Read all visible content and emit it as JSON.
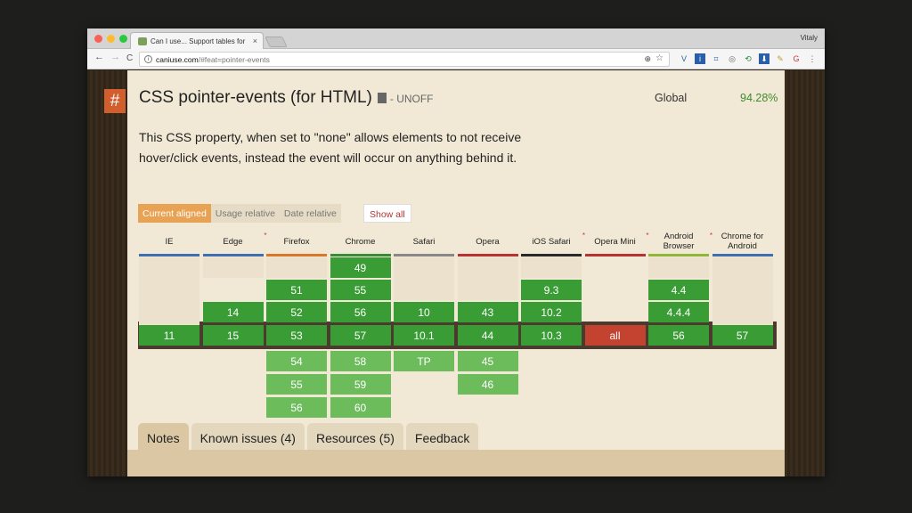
{
  "window": {
    "tab_title": "Can I use... Support tables for",
    "tab_close": "×",
    "user": "Vitaly"
  },
  "toolbar": {
    "back": "←",
    "forward": "→",
    "reload": "C",
    "info": "i",
    "url_host": "caniuse.com",
    "url_path": "/#feat=pointer-events",
    "zoom": "⊕",
    "star": "☆",
    "extensions": [
      "V",
      "i",
      "⌗",
      "◎",
      "⟲",
      "⬇",
      "✎",
      "G",
      "⋮"
    ]
  },
  "page": {
    "hash": "#",
    "title": "CSS pointer-events (for HTML)",
    "status": "- UNOFF",
    "global_label": "Global",
    "global_pct": "94.28%",
    "description": "This CSS property, when set to \"none\" allows elements to not receive hover/click events, instead the event will occur on anything behind it.",
    "view_buttons": [
      "Current aligned",
      "Usage relative",
      "Date relative"
    ],
    "show_all": "Show all",
    "browsers": [
      {
        "name": "IE",
        "color": "#3f6fb0",
        "note": "",
        "cells": [
          [
            "",
            "empty"
          ],
          [
            "",
            "empty"
          ],
          [
            "",
            "empty"
          ],
          [
            "11",
            "cur"
          ],
          [
            "",
            "none"
          ],
          [
            "",
            "none"
          ],
          [
            "",
            "none"
          ]
        ]
      },
      {
        "name": "Edge",
        "color": "#3f6fb0",
        "note": "*",
        "cells": [
          [
            "",
            "none"
          ],
          [
            "",
            "empty"
          ],
          [
            "14",
            "old"
          ],
          [
            "15",
            "cur"
          ],
          [
            "",
            "none"
          ],
          [
            "",
            "none"
          ],
          [
            "",
            "none"
          ]
        ]
      },
      {
        "name": "Firefox",
        "color": "#d9772b",
        "note": "",
        "cells": [
          [
            "",
            "empty"
          ],
          [
            "51",
            "old"
          ],
          [
            "52",
            "old"
          ],
          [
            "53",
            "cur"
          ],
          [
            "54",
            "fut"
          ],
          [
            "55",
            "fut"
          ],
          [
            "56",
            "fut"
          ]
        ]
      },
      {
        "name": "Chrome",
        "color": "#3a8a3a",
        "note": "",
        "cells": [
          [
            "49",
            "old"
          ],
          [
            "55",
            "old"
          ],
          [
            "56",
            "old"
          ],
          [
            "57",
            "cur"
          ],
          [
            "58",
            "fut"
          ],
          [
            "59",
            "fut"
          ],
          [
            "60",
            "fut"
          ]
        ]
      },
      {
        "name": "Safari",
        "color": "#888888",
        "note": "",
        "cells": [
          [
            "",
            "empty"
          ],
          [
            "",
            "empty"
          ],
          [
            "10",
            "old"
          ],
          [
            "10.1",
            "cur"
          ],
          [
            "TP",
            "fut"
          ],
          [
            "",
            "none"
          ],
          [
            "",
            "none"
          ]
        ]
      },
      {
        "name": "Opera",
        "color": "#b93232",
        "note": "",
        "cells": [
          [
            "",
            "empty"
          ],
          [
            "",
            "empty"
          ],
          [
            "43",
            "old"
          ],
          [
            "44",
            "cur"
          ],
          [
            "45",
            "fut"
          ],
          [
            "46",
            "fut"
          ],
          [
            "",
            "none"
          ]
        ]
      },
      {
        "name": "iOS Safari",
        "color": "#2a2a2a",
        "note": "*",
        "cells": [
          [
            "",
            "empty"
          ],
          [
            "9.3",
            "old"
          ],
          [
            "10.2",
            "old"
          ],
          [
            "10.3",
            "cur"
          ],
          [
            "",
            "none"
          ],
          [
            "",
            "none"
          ],
          [
            "",
            "none"
          ]
        ]
      },
      {
        "name": "Opera Mini",
        "color": "#b93232",
        "note": "*",
        "cells": [
          [
            "",
            "none"
          ],
          [
            "",
            "none"
          ],
          [
            "",
            "none"
          ],
          [
            "all",
            "bad"
          ],
          [
            "",
            "none"
          ],
          [
            "",
            "none"
          ],
          [
            "",
            "none"
          ]
        ]
      },
      {
        "name": "Android Browser",
        "color": "#8fb83b",
        "note": "*",
        "cells": [
          [
            "",
            "empty"
          ],
          [
            "4.4",
            "old"
          ],
          [
            "4.4.4",
            "old"
          ],
          [
            "56",
            "cur"
          ],
          [
            "",
            "none"
          ],
          [
            "",
            "none"
          ],
          [
            "",
            "none"
          ]
        ]
      },
      {
        "name": "Chrome for Android",
        "color": "#3f6fb0",
        "note": "",
        "cells": [
          [
            "",
            "empty"
          ],
          [
            "",
            "empty"
          ],
          [
            "",
            "empty"
          ],
          [
            "57",
            "cur"
          ],
          [
            "",
            "none"
          ],
          [
            "",
            "none"
          ],
          [
            "",
            "none"
          ]
        ]
      }
    ],
    "bottom_tabs": [
      "Notes",
      "Known issues (4)",
      "Resources (5)",
      "Feedback"
    ]
  },
  "colors": {
    "supported": "#3a9c34",
    "future": "#6cbc5c",
    "unsupported": "#c44230",
    "accent": "#e8a253"
  }
}
